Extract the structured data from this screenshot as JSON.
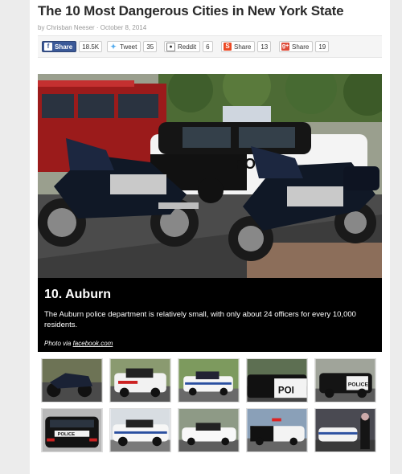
{
  "article": {
    "title": "The 10 Most Dangerous Cities in New York State",
    "byline": "by Chrisban Neeser · October 8, 2014"
  },
  "share": {
    "facebook": {
      "label": "Share",
      "count": "18.5K",
      "icon": "facebook-icon"
    },
    "twitter": {
      "label": "Tweet",
      "count": "35",
      "icon": "twitter-icon"
    },
    "reddit": {
      "label": "Reddit",
      "count": "6",
      "icon": "reddit-icon"
    },
    "stumbleupon": {
      "label": "Share",
      "count": "13",
      "icon": "stumbleupon-icon"
    },
    "googleplus": {
      "label": "Share",
      "count": "19",
      "icon": "googleplus-icon"
    }
  },
  "slide": {
    "heading": "10. Auburn",
    "text": "The Auburn police department is relatively small, with only about 24 officers for every 10,000 residents.",
    "credit_prefix": "Photo via ",
    "credit_link": "facebook.com"
  },
  "colors": {
    "facebook": "#3b5998",
    "twitter": "#55acee",
    "stumbleupon": "#eb4924",
    "googleplus": "#dd4b39",
    "caption_bg": "#000000"
  }
}
